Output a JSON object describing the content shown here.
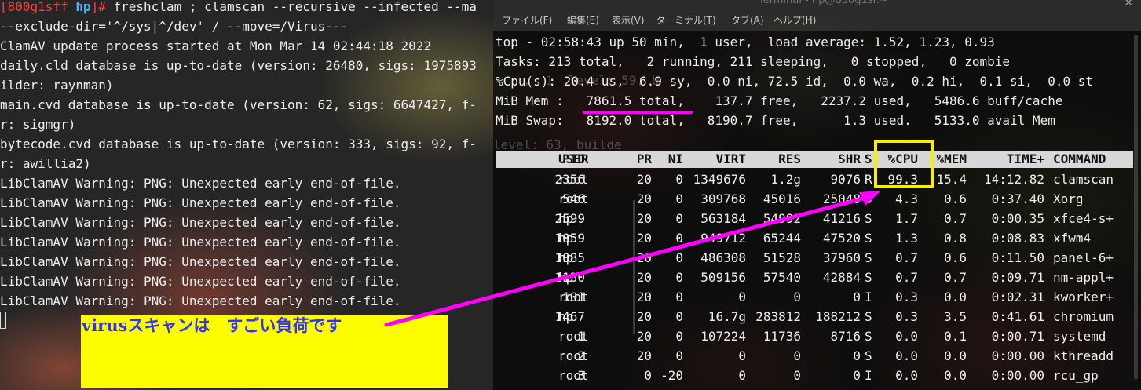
{
  "colors": {
    "prompt_user": "#ff3b3b",
    "prompt_host": "#4db2ff",
    "highlight_box": "#f7ee00",
    "annotation_arrow": "#ff00ff",
    "callout_bg": "#fdfd00",
    "callout_text": "#3232ff"
  },
  "left_terminal": {
    "prompt_user": "[800g1sff ",
    "prompt_host": "hp",
    "prompt_end": "]# ",
    "command": "freshclam ; clamscan --recursive --infected --ma",
    "lines": [
      "--exclude-dir='^/sys|^/dev' / --move=/Virus---",
      "ClamAV update process started at Mon Mar 14 02:44:18 2022",
      "daily.cld database is up-to-date (version: 26480, sigs: 1975893",
      "ilder: raynman)",
      "main.cvd database is up-to-date (version: 62, sigs: 6647427, f-",
      "r: sigmgr)",
      "bytecode.cvd database is up-to-date (version: 333, sigs: 92, f-",
      "r: awillia2)",
      "LibClamAV Warning: PNG: Unexpected early end-of-file.",
      "LibClamAV Warning: PNG: Unexpected early end-of-file.",
      "LibClamAV Warning: PNG: Unexpected early end-of-file.",
      "LibClamAV Warning: PNG: Unexpected early end-of-file.",
      "LibClamAV Warning: PNG: Unexpected early end-of-file.",
      "LibClamAV Warning: PNG: Unexpected early end-of-file.",
      "LibClamAV Warning: PNG: Unexpected early end-of-file."
    ]
  },
  "right_terminal": {
    "window_title": "Terminal - hp@800g1sf:~",
    "menu": [
      "ファイル(F)",
      "編集(E)",
      "表示(V)",
      "ターミナル(T)",
      "タブ(A)",
      "ヘルプ(H)"
    ],
    "summary": [
      "top - 02:58:43 up 50 min,  1 user,  load average: 1.52, 1.23, 0.93",
      "Tasks: 213 total,   2 running, 211 sleeping,   0 stopped,   0 zombie",
      "%Cpu(s): 20.4 us,  6.9 sy,  0.0 ni, 72.5 id,  0.0 wa,  0.2 hi,  0.1 si,  0.0 st",
      "MiB Mem :   7861.5 total,    137.7 free,   2237.2 used,   5486.6 buff/cache",
      "MiB Swap:   8192.0 total,   8190.7 free,      1.3 used.   5133.0 avail Mem"
    ],
    "ghost_lines": [
      ",  1  level: 59, b",
      "level: 63, builde"
    ],
    "columns": [
      "PID",
      "USER",
      "PR",
      "NI",
      "VIRT",
      "RES",
      "SHR",
      "S",
      "%CPU",
      "%MEM",
      "TIME+",
      "COMMAND"
    ],
    "processes": [
      [
        "2356",
        "root",
        "20",
        "0",
        "1349676",
        "1.2g",
        "9076",
        "R",
        "99.3",
        "15.4",
        "14:12.82",
        "clamscan"
      ],
      [
        "546",
        "root",
        "20",
        "0",
        "309768",
        "45016",
        "25048",
        "S",
        "4.3",
        "0.6",
        "0:37.40",
        "Xorg"
      ],
      [
        "2599",
        "hp",
        "20",
        "0",
        "563184",
        "54992",
        "41216",
        "S",
        "1.7",
        "0.7",
        "0:00.35",
        "xfce4-s+"
      ],
      [
        "1059",
        "hp",
        "20",
        "0",
        "949712",
        "65244",
        "47520",
        "S",
        "1.3",
        "0.8",
        "0:08.83",
        "xfwm4"
      ],
      [
        "1085",
        "hp",
        "20",
        "0",
        "486308",
        "51528",
        "37960",
        "S",
        "0.7",
        "0.6",
        "0:11.50",
        "panel-6+"
      ],
      [
        "1130",
        "hp",
        "20",
        "0",
        "509156",
        "57540",
        "42884",
        "S",
        "0.7",
        "0.7",
        "0:09.71",
        "nm-appl+"
      ],
      [
        "101",
        "root",
        "20",
        "0",
        "0",
        "0",
        "0",
        "I",
        "0.3",
        "0.0",
        "0:02.31",
        "kworker+"
      ],
      [
        "1467",
        "hp",
        "20",
        "0",
        "16.7g",
        "283812",
        "188212",
        "S",
        "0.3",
        "3.5",
        "0:41.61",
        "chromium"
      ],
      [
        "1",
        "root",
        "20",
        "0",
        "107224",
        "11736",
        "8716",
        "S",
        "0.0",
        "0.1",
        "0:00.71",
        "systemd"
      ],
      [
        "2",
        "root",
        "20",
        "0",
        "0",
        "0",
        "0",
        "S",
        "0.0",
        "0.0",
        "0:00.00",
        "kthreadd"
      ],
      [
        "3",
        "root",
        "0",
        "-20",
        "0",
        "0",
        "0",
        "I",
        "0.0",
        "0.0",
        "0:00.00",
        "rcu_gp"
      ]
    ]
  },
  "annotation": {
    "callout_text": "virusスキャンは　すごい負荷です"
  }
}
